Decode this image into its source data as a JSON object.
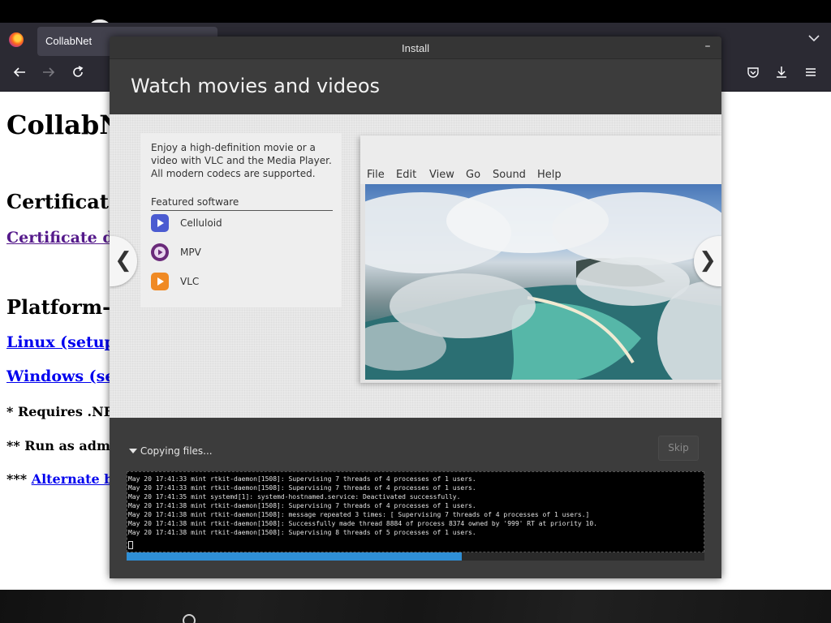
{
  "browser": {
    "tab_title": "CollabNet",
    "tab_list_icon": "chevron-down-icon",
    "nav_icons": [
      "back-arrow-icon",
      "forward-arrow-icon",
      "reload-icon"
    ],
    "toolbar_icons": [
      "pocket-icon",
      "download-icon",
      "hamburger-menu-icon"
    ]
  },
  "page": {
    "title": "CollabN",
    "certificate_heading": "Certificat",
    "certificate_link": "Certificate d",
    "platform_heading": "Platform-",
    "linux_link": "Linux (setup",
    "windows_link": "Windows (se",
    "note1": "* Requires .NE",
    "note2": "** Run as adm",
    "note3_prefix": "*** ",
    "note3_link": "Alternate b"
  },
  "installer": {
    "window_title": "Install",
    "minimize_label": "–",
    "heading": "Watch movies and videos",
    "description": "Enjoy a high-definition movie or a video with VLC and the Media Player. All modern codecs are supported.",
    "featured_label": "Featured software",
    "software": [
      {
        "name": "Celluloid",
        "icon": "celluloid-icon",
        "color": "#4b5bd1"
      },
      {
        "name": "MPV",
        "icon": "mpv-icon",
        "color": "#6a2a7a"
      },
      {
        "name": "VLC",
        "icon": "vlc-icon",
        "color": "#f08a24"
      }
    ],
    "player_menu": [
      "File",
      "Edit",
      "View",
      "Go",
      "Sound",
      "Help"
    ],
    "prev_arrow": "❮",
    "next_arrow": "❯",
    "status": "Copying files...",
    "skip_label": "Skip",
    "log_lines": [
      "May 20 17:41:33 mint rtkit-daemon[1508]: Supervising 7 threads of 4 processes of 1 users.",
      "May 20 17:41:33 mint rtkit-daemon[1508]: Supervising 7 threads of 4 processes of 1 users.",
      "May 20 17:41:35 mint systemd[1]: systemd-hostnamed.service: Deactivated successfully.",
      "May 20 17:41:38 mint rtkit-daemon[1508]: Supervising 7 threads of 4 processes of 1 users.",
      "May 20 17:41:38 mint rtkit-daemon[1508]: message repeated 3 times: [ Supervising 7 threads of 4 processes of 1 users.]",
      "May 20 17:41:38 mint rtkit-daemon[1508]: Successfully made thread 8884 of process 8374 owned by '999' RT at priority 10.",
      "May 20 17:41:38 mint rtkit-daemon[1508]: Supervising 8 threads of 5 processes of 1 users."
    ],
    "progress_fraction": 0.58,
    "progress_color": "#2f8fd6"
  }
}
